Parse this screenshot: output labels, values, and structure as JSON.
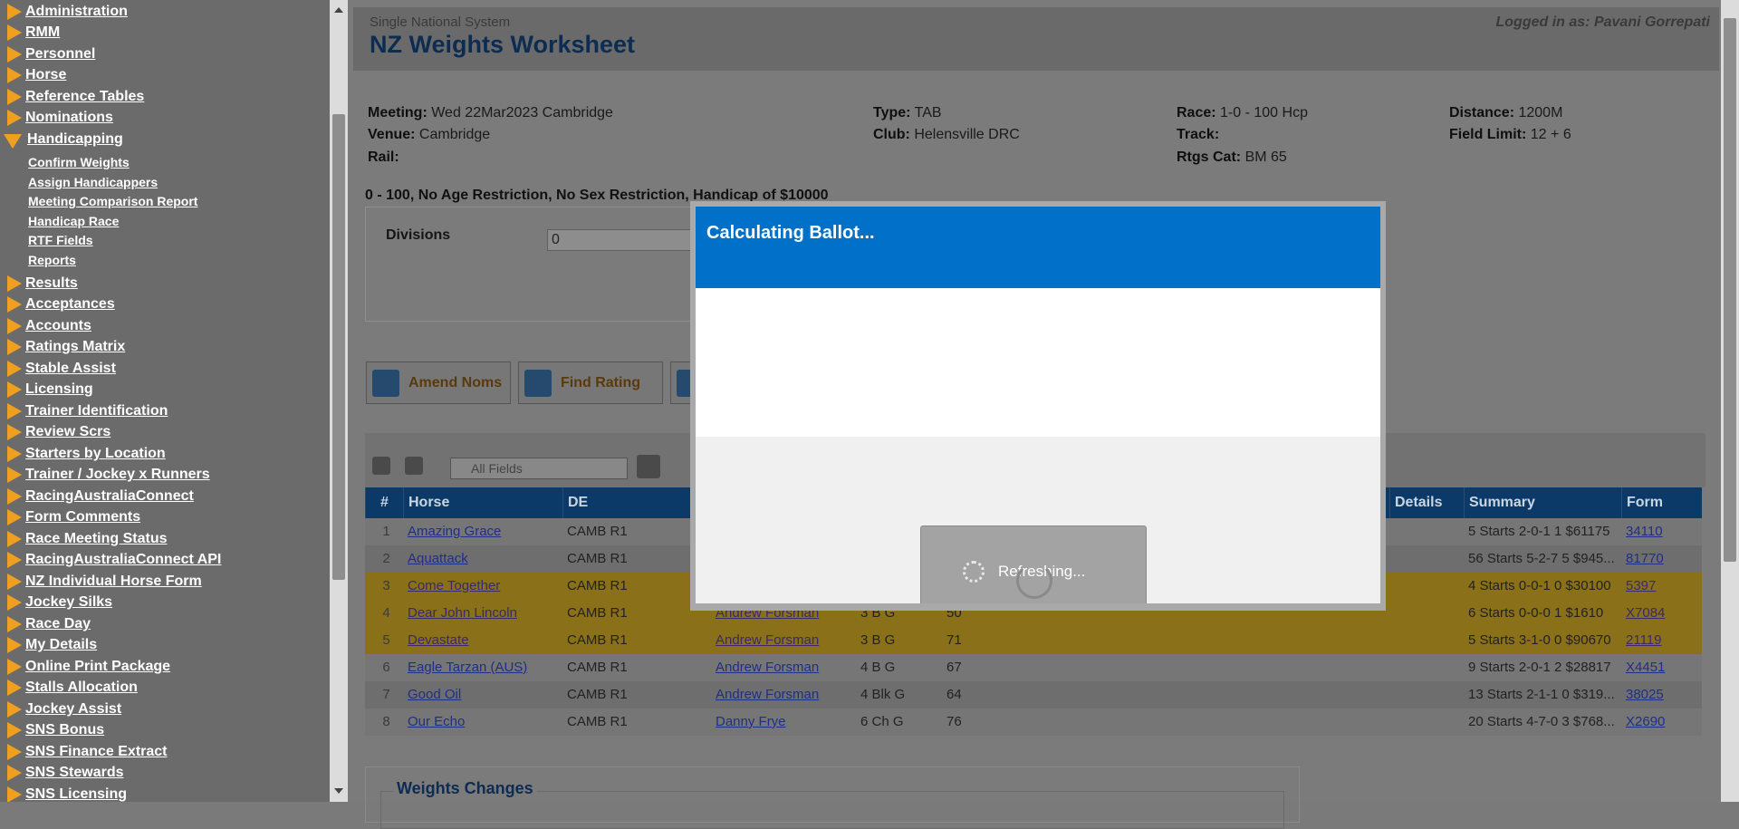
{
  "sidebar": {
    "items": [
      {
        "label": "Administration"
      },
      {
        "label": "RMM"
      },
      {
        "label": "Personnel"
      },
      {
        "label": "Horse"
      },
      {
        "label": "Reference Tables"
      },
      {
        "label": "Nominations"
      },
      {
        "label": "Handicapping"
      },
      {
        "label": "Results"
      },
      {
        "label": "Acceptances"
      },
      {
        "label": "Accounts"
      },
      {
        "label": "Ratings Matrix"
      },
      {
        "label": "Stable Assist"
      },
      {
        "label": "Licensing"
      },
      {
        "label": "Trainer Identification"
      },
      {
        "label": "Review Scrs"
      },
      {
        "label": "Starters by Location"
      },
      {
        "label": "Trainer / Jockey x Runners"
      },
      {
        "label": "RacingAustraliaConnect"
      },
      {
        "label": "Form Comments"
      },
      {
        "label": "Race Meeting Status"
      },
      {
        "label": "RacingAustraliaConnect API"
      },
      {
        "label": "NZ Individual Horse Form"
      },
      {
        "label": "Jockey Silks"
      },
      {
        "label": "Race Day"
      },
      {
        "label": "My Details"
      },
      {
        "label": "Online Print Package"
      },
      {
        "label": "Stalls Allocation"
      },
      {
        "label": "Jockey Assist"
      },
      {
        "label": "SNS Bonus"
      },
      {
        "label": "SNS Finance Extract"
      },
      {
        "label": "SNS Stewards"
      },
      {
        "label": "SNS Licensing"
      }
    ],
    "sub_items": [
      {
        "label": "Confirm Weights"
      },
      {
        "label": "Assign Handicappers"
      },
      {
        "label": "Meeting Comparison Report"
      },
      {
        "label": "Handicap Race"
      },
      {
        "label": "RTF Fields"
      },
      {
        "label": "Reports"
      }
    ]
  },
  "header": {
    "system": "Single National System",
    "title": "NZ Weights Worksheet",
    "login": "Logged in as: Pavani Gorrepati"
  },
  "meeting": {
    "meeting_label": "Meeting:",
    "meeting_value": "Wed 22Mar2023 Cambridge",
    "venue_label": "Venue:",
    "venue_value": "Cambridge",
    "rail_label": "Rail:",
    "type_label": "Type:",
    "type_value": "TAB",
    "club_label": "Club:",
    "club_value": "Helensville DRC",
    "race_label": "Race:",
    "race_value": "1-0 - 100 Hcp",
    "track_label": "Track:",
    "rtgs_label": "Rtgs Cat:",
    "rtgs_value": "BM 65",
    "distance_label": "Distance:",
    "distance_value": "1200M",
    "field_label": "Field Limit:",
    "field_value": "12 + 6"
  },
  "restriction": "0 - 100, No Age Restriction, No Sex Restriction, Handicap of $10000",
  "divisions": {
    "label": "Divisions",
    "value": "0"
  },
  "toolbar": {
    "amend_noms": "Amend Noms",
    "find_rating": "Find Rating"
  },
  "grid": {
    "search_placeholder": "All Fields",
    "headers": {
      "num": "#",
      "horse": "Horse",
      "de": "DE",
      "details": "Details",
      "summary": "Summary",
      "form": "Form"
    },
    "rows": [
      {
        "num": "1",
        "horse": "Amazing Grace",
        "de": "CAMB R1",
        "trainer": "",
        "age": "",
        "rating": "",
        "summary": "5 Starts 2-0-1 1 $61175",
        "form": "34110",
        "style": "grey"
      },
      {
        "num": "2",
        "horse": "Aquattack",
        "de": "CAMB R1",
        "trainer": "",
        "age": "",
        "rating": "",
        "summary": "56 Starts 5-2-7 5 $945...",
        "form": "81770",
        "style": "grey2"
      },
      {
        "num": "3",
        "horse": "Come Together",
        "de": "CAMB R1",
        "trainer": "",
        "age": "",
        "rating": "",
        "summary": "4 Starts 0-0-1 0 $30100",
        "form": "5397",
        "style": "orange"
      },
      {
        "num": "4",
        "horse": "Dear John Lincoln",
        "de": "CAMB R1",
        "trainer": "Andrew Forsman",
        "age": "3 B G",
        "rating": "50",
        "summary": "6 Starts 0-0-0 1 $1610",
        "form": "X7084",
        "style": "orange"
      },
      {
        "num": "5",
        "horse": "Devastate",
        "de": "CAMB R1",
        "trainer": "Andrew Forsman",
        "age": "3 B G",
        "rating": "71",
        "summary": "5 Starts 3-1-0 0 $90670",
        "form": "21119",
        "style": "orange"
      },
      {
        "num": "6",
        "horse": "Eagle Tarzan (AUS)",
        "de": "CAMB R1",
        "trainer": "Andrew Forsman",
        "age": "4 B G",
        "rating": "67",
        "summary": "9 Starts 2-0-1 2 $28817",
        "form": "X4451",
        "style": "grey"
      },
      {
        "num": "7",
        "horse": "Good Oil",
        "de": "CAMB R1",
        "trainer": "Andrew Forsman",
        "age": "4 Blk G",
        "rating": "64",
        "summary": "13 Starts 2-1-1 0 $319...",
        "form": "38025",
        "style": "grey2"
      },
      {
        "num": "8",
        "horse": "Our Echo",
        "de": "CAMB R1",
        "trainer": "Danny Frye",
        "age": "6 Ch G",
        "rating": "76",
        "summary": "20 Starts 4-7-0 3 $768...",
        "form": "X2690",
        "style": "grey"
      }
    ]
  },
  "weights_changes": {
    "label": "Weights Changes"
  },
  "modal": {
    "title": "Calculating Ballot...",
    "loading": "Refreshing..."
  }
}
